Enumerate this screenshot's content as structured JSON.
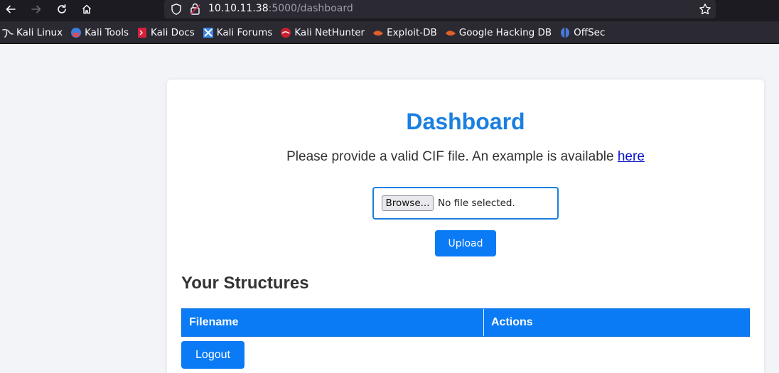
{
  "browser": {
    "url_host": "10.10.11.38",
    "url_rest": ":5000/dashboard",
    "bookmarks": [
      {
        "label": "Kali Linux",
        "icon": "kali-dragon-icon"
      },
      {
        "label": "Kali Tools",
        "icon": "kali-tools-icon"
      },
      {
        "label": "Kali Docs",
        "icon": "kali-docs-icon"
      },
      {
        "label": "Kali Forums",
        "icon": "kali-forums-icon"
      },
      {
        "label": "Kali NetHunter",
        "icon": "kali-nethunter-icon"
      },
      {
        "label": "Exploit-DB",
        "icon": "exploit-db-icon"
      },
      {
        "label": "Google Hacking DB",
        "icon": "ghdb-icon"
      },
      {
        "label": "OffSec",
        "icon": "offsec-icon"
      }
    ]
  },
  "page": {
    "title": "Dashboard",
    "intro_text": "Please provide a valid CIF file. An example is available ",
    "intro_link": "here",
    "file_input": {
      "browse_label": "Browse...",
      "status": "No file selected."
    },
    "upload_label": "Upload",
    "structures_title": "Your Structures",
    "table": {
      "columns": [
        "Filename",
        "Actions"
      ]
    },
    "logout_label": "Logout"
  },
  "colors": {
    "accent": "#0a7bf5",
    "title": "#1a7fe0",
    "link": "#0a14c8"
  }
}
